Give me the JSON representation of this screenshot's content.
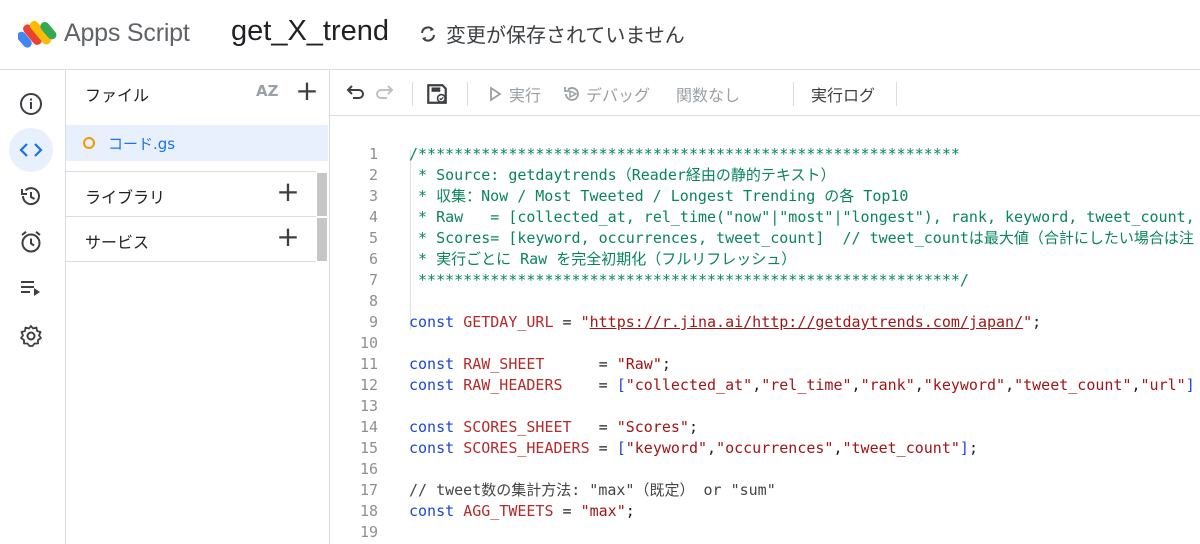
{
  "header": {
    "app_name": "Apps Script",
    "project_title": "get_X_trend",
    "save_status": "変更が保存されていません"
  },
  "rail": {
    "items": [
      {
        "name": "info-icon"
      },
      {
        "name": "code-icon",
        "active": true
      },
      {
        "name": "history-icon"
      },
      {
        "name": "alarm-icon"
      },
      {
        "name": "executions-icon"
      },
      {
        "name": "settings-icon"
      }
    ]
  },
  "files": {
    "title": "ファイル",
    "sort_label": "AZ",
    "file_name": "コード.gs",
    "libraries_label": "ライブラリ",
    "services_label": "サービス"
  },
  "toolbar": {
    "run_label": "実行",
    "debug_label": "デバッグ",
    "function_label": "関数なし",
    "log_label": "実行ログ"
  },
  "editor": {
    "lines": [
      {
        "n": "1",
        "parts": [
          {
            "t": "/************************************************************",
            "c": "c-comment"
          }
        ]
      },
      {
        "n": "2",
        "parts": [
          {
            "t": " * Source: getdaytrends（Reader経由の静的テキスト）",
            "c": "c-comment"
          }
        ]
      },
      {
        "n": "3",
        "parts": [
          {
            "t": " * 収集：Now / Most Tweeted / Longest Trending の各 Top10",
            "c": "c-comment"
          }
        ]
      },
      {
        "n": "4",
        "parts": [
          {
            "t": " * Raw   = [collected_at, rel_time(\"now\"|\"most\"|\"longest\"), rank, keyword, tweet_count, url",
            "c": "c-comment"
          }
        ]
      },
      {
        "n": "5",
        "parts": [
          {
            "t": " * Scores= [keyword, occurrences, tweet_count]  // tweet_countは最大値（合計にしたい場合は注",
            "c": "c-comment"
          }
        ]
      },
      {
        "n": "6",
        "parts": [
          {
            "t": " * 実行ごとに Raw を完全初期化（フルリフレッシュ）",
            "c": "c-comment"
          }
        ]
      },
      {
        "n": "7",
        "parts": [
          {
            "t": " ************************************************************/",
            "c": "c-comment"
          }
        ]
      },
      {
        "n": "8",
        "parts": []
      },
      {
        "n": "9",
        "parts": [
          {
            "t": "const ",
            "c": "c-key"
          },
          {
            "t": "GETDAY_URL",
            "c": "c-var"
          },
          {
            "t": " = ",
            "c": "c-punct"
          },
          {
            "t": "\"",
            "c": "c-str"
          },
          {
            "t": "https://r.jina.ai/http://getdaytrends.com/japan/",
            "c": "c-url"
          },
          {
            "t": "\"",
            "c": "c-str"
          },
          {
            "t": ";",
            "c": "c-punct"
          }
        ]
      },
      {
        "n": "10",
        "parts": []
      },
      {
        "n": "11",
        "parts": [
          {
            "t": "const ",
            "c": "c-key"
          },
          {
            "t": "RAW_SHEET",
            "c": "c-var"
          },
          {
            "t": "      = ",
            "c": "c-punct"
          },
          {
            "t": "\"Raw\"",
            "c": "c-str"
          },
          {
            "t": ";",
            "c": "c-punct"
          }
        ]
      },
      {
        "n": "12",
        "parts": [
          {
            "t": "const ",
            "c": "c-key"
          },
          {
            "t": "RAW_HEADERS",
            "c": "c-var"
          },
          {
            "t": "    = ",
            "c": "c-punct"
          },
          {
            "t": "[",
            "c": "c-key"
          },
          {
            "t": "\"collected_at\"",
            "c": "c-str"
          },
          {
            "t": ",",
            "c": "c-punct"
          },
          {
            "t": "\"rel_time\"",
            "c": "c-str"
          },
          {
            "t": ",",
            "c": "c-punct"
          },
          {
            "t": "\"rank\"",
            "c": "c-str"
          },
          {
            "t": ",",
            "c": "c-punct"
          },
          {
            "t": "\"keyword\"",
            "c": "c-str"
          },
          {
            "t": ",",
            "c": "c-punct"
          },
          {
            "t": "\"tweet_count\"",
            "c": "c-str"
          },
          {
            "t": ",",
            "c": "c-punct"
          },
          {
            "t": "\"url\"",
            "c": "c-str"
          },
          {
            "t": "]",
            "c": "c-key"
          }
        ]
      },
      {
        "n": "13",
        "parts": []
      },
      {
        "n": "14",
        "parts": [
          {
            "t": "const ",
            "c": "c-key"
          },
          {
            "t": "SCORES_SHEET",
            "c": "c-var"
          },
          {
            "t": "   = ",
            "c": "c-punct"
          },
          {
            "t": "\"Scores\"",
            "c": "c-str"
          },
          {
            "t": ";",
            "c": "c-punct"
          }
        ]
      },
      {
        "n": "15",
        "parts": [
          {
            "t": "const ",
            "c": "c-key"
          },
          {
            "t": "SCORES_HEADERS",
            "c": "c-var"
          },
          {
            "t": " = ",
            "c": "c-punct"
          },
          {
            "t": "[",
            "c": "c-key"
          },
          {
            "t": "\"keyword\"",
            "c": "c-str"
          },
          {
            "t": ",",
            "c": "c-punct"
          },
          {
            "t": "\"occurrences\"",
            "c": "c-str"
          },
          {
            "t": ",",
            "c": "c-punct"
          },
          {
            "t": "\"tweet_count\"",
            "c": "c-str"
          },
          {
            "t": "]",
            "c": "c-key"
          },
          {
            "t": ";",
            "c": "c-punct"
          }
        ]
      },
      {
        "n": "16",
        "parts": []
      },
      {
        "n": "17",
        "parts": [
          {
            "t": "// tweet数の集計方法: \"max\"（既定） or \"sum\"",
            "c": "c-gray"
          }
        ]
      },
      {
        "n": "18",
        "parts": [
          {
            "t": "const ",
            "c": "c-key"
          },
          {
            "t": "AGG_TWEETS",
            "c": "c-var"
          },
          {
            "t": " = ",
            "c": "c-punct"
          },
          {
            "t": "\"max\"",
            "c": "c-str"
          },
          {
            "t": ";",
            "c": "c-punct"
          }
        ]
      },
      {
        "n": "19",
        "parts": []
      }
    ]
  }
}
